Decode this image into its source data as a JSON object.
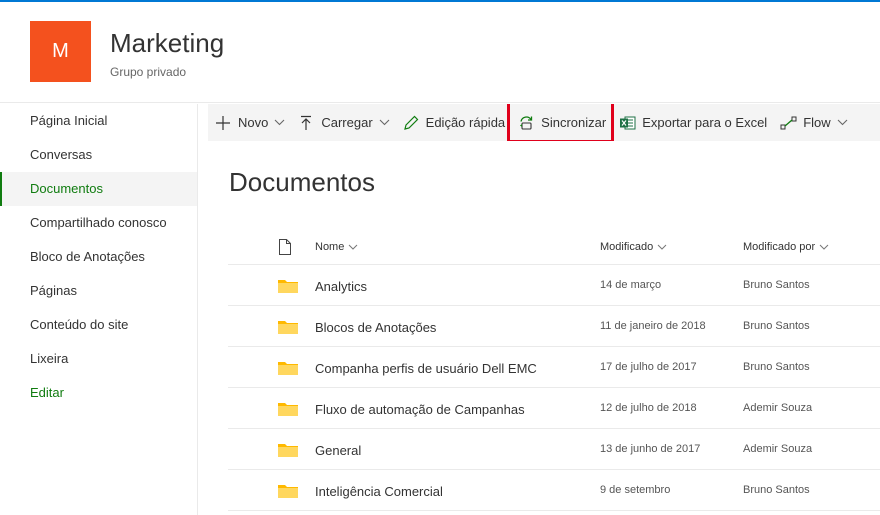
{
  "site": {
    "logo_letter": "M",
    "title": "Marketing",
    "subtitle": "Grupo privado"
  },
  "nav": {
    "items": [
      {
        "label": "Página Inicial"
      },
      {
        "label": "Conversas"
      },
      {
        "label": "Documentos",
        "selected": true
      },
      {
        "label": "Compartilhado conosco"
      },
      {
        "label": "Bloco de Anotações"
      },
      {
        "label": "Páginas"
      },
      {
        "label": "Conteúdo do site"
      },
      {
        "label": "Lixeira"
      }
    ],
    "edit_label": "Editar"
  },
  "commands": {
    "new_label": "Novo",
    "upload_label": "Carregar",
    "quick_edit_label": "Edição rápida",
    "sync_label": "Sincronizar",
    "export_label": "Exportar para o Excel",
    "flow_label": "Flow"
  },
  "page": {
    "title": "Documentos"
  },
  "list": {
    "columns": {
      "name": "Nome",
      "modified": "Modificado",
      "modified_by": "Modificado por"
    },
    "rows": [
      {
        "name": "Analytics",
        "modified": "14 de março",
        "modified_by": "Bruno Santos"
      },
      {
        "name": "Blocos de Anotações",
        "modified": "11 de janeiro de 2018",
        "modified_by": "Bruno Santos"
      },
      {
        "name": "Companha perfis de usuário Dell EMC",
        "modified": "17 de julho de 2017",
        "modified_by": "Bruno Santos"
      },
      {
        "name": "Fluxo de automação de Campanhas",
        "modified": "12 de julho de 2018",
        "modified_by": "Ademir Souza"
      },
      {
        "name": "General",
        "modified": "13 de junho de 2017",
        "modified_by": "Ademir Souza"
      },
      {
        "name": "Inteligência Comercial",
        "modified": "9 de setembro",
        "modified_by": "Bruno Santos"
      }
    ]
  },
  "colors": {
    "logo": "#f4511e",
    "accent_green": "#107c10",
    "highlight_red": "#e0001b",
    "folder_yellow": "#ffb900"
  }
}
